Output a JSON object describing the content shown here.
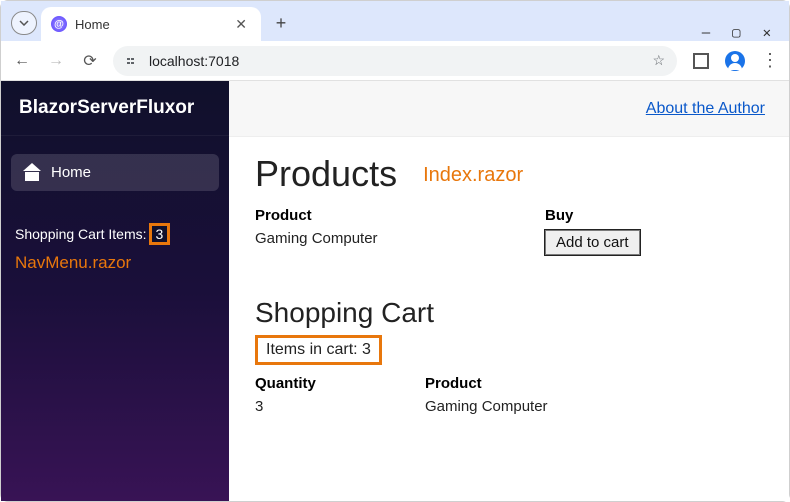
{
  "browser": {
    "tab_title": "Home",
    "url": "localhost:7018"
  },
  "sidebar": {
    "brand": "BlazorServerFluxor",
    "home_label": "Home",
    "cart_label_prefix": "Shopping Cart Items:",
    "cart_count": "3",
    "annotation": "NavMenu.razor"
  },
  "topbar": {
    "about_link": "About the Author"
  },
  "products": {
    "heading": "Products",
    "annotation": "Index.razor",
    "columns": {
      "product": "Product",
      "buy": "Buy"
    },
    "rows": [
      {
        "name": "Gaming Computer",
        "action_label": "Add to cart"
      }
    ]
  },
  "cart": {
    "heading": "Shopping Cart",
    "items_in_cart_label": "Items in cart: 3",
    "columns": {
      "quantity": "Quantity",
      "product": "Product"
    },
    "rows": [
      {
        "quantity": "3",
        "product": "Gaming Computer"
      }
    ]
  }
}
